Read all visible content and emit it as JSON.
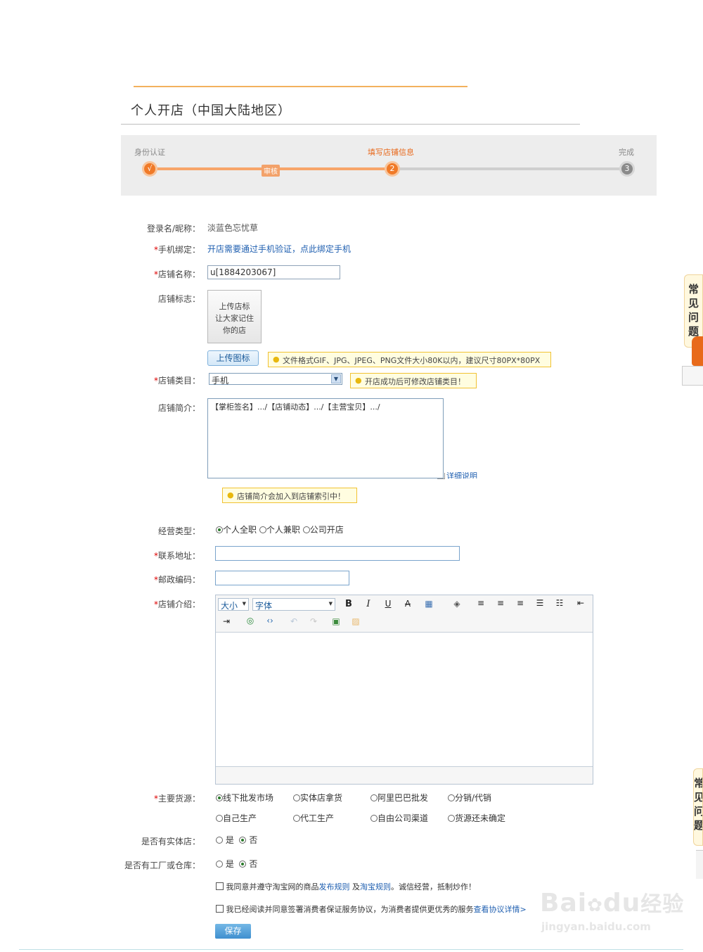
{
  "page": {
    "title": "个人开店（中国大陆地区）"
  },
  "steps": [
    {
      "label": "身份认证",
      "marker": "√"
    },
    {
      "label": "审核"
    },
    {
      "label": "填写店铺信息",
      "marker": "2"
    },
    {
      "label": "完成",
      "marker": "3"
    }
  ],
  "colors": {
    "accent_orange": "#f07a28",
    "link_blue": "#1f5fb0",
    "required_red": "#d00000",
    "tip_border": "#f1c232"
  },
  "form": {
    "login": {
      "label": "登录名/昵称：",
      "value": "淡蓝色忘忧草"
    },
    "phone": {
      "label": "手机绑定：",
      "link": "开店需要通过手机验证，点此绑定手机"
    },
    "shop_name": {
      "label": "店铺名称：",
      "value": "u[1884203067]"
    },
    "shop_logo": {
      "label": "店铺标志：",
      "upload_box": [
        "上传店标",
        "让大家记住",
        "你的店"
      ],
      "upload_button": "上传图标",
      "tip": "文件格式GIF、JPG、JPEG、PNG文件大小80K以内，建议尺寸80PX*80PX"
    },
    "category": {
      "label": "店铺类目：",
      "value": "手机",
      "tip": "开店成功后可修改店铺类目！"
    },
    "intro": {
      "label": "店铺简介：",
      "value": "【掌柜签名】.../【店铺动态】.../【主营宝贝】.../",
      "detail_link": "详细说明",
      "tip": "店铺简介会加入到店铺索引中！"
    },
    "business_type": {
      "label": "经营类型：",
      "options": [
        "个人全职",
        "个人兼职",
        "公司开店"
      ],
      "selected": "个人全职"
    },
    "address": {
      "label": "联系地址：",
      "value": ""
    },
    "postcode": {
      "label": "邮政编码：",
      "value": ""
    },
    "description": {
      "label": "店铺介绍：",
      "font_size": "大小",
      "font_family": "字体"
    },
    "source": {
      "label": "主要货源：",
      "options": [
        "线下批发市场",
        "实体店拿货",
        "阿里巴巴批发",
        "分销/代销",
        "自己生产",
        "代工生产",
        "自由公司渠道",
        "货源还未确定"
      ],
      "selected": "线下批发市场"
    },
    "physical_store": {
      "label": "是否有实体店：",
      "options": [
        "是",
        "否"
      ],
      "selected": "否"
    },
    "factory": {
      "label": "是否有工厂或仓库：",
      "options": [
        "是",
        "否"
      ],
      "selected": "否"
    },
    "agree1": {
      "text1": "我同意并遵守淘宝网的商品",
      "link1": "发布规则",
      "text2": " 及",
      "link2": "淘宝规则",
      "text3": "。诚信经营，抵制炒作！"
    },
    "agree2": {
      "text": "我已经阅读并同意签署消费者保证服务协议，为消费者提供更优秀的服务",
      "link": "查看协议详情>"
    },
    "save": "保存"
  },
  "sidebar": {
    "faq_chars": [
      "常",
      "见",
      "问",
      "题"
    ]
  },
  "watermark": {
    "brand": "Bai",
    "brand2": "du",
    "jingyan": "经验",
    "url": "jingyan.baidu.com"
  }
}
